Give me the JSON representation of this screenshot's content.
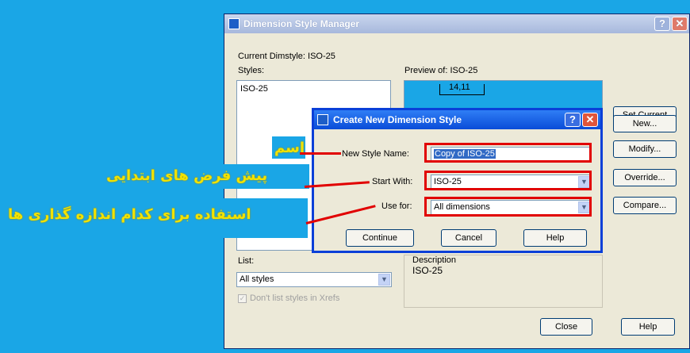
{
  "main_dialog": {
    "title": "Dimension Style Manager",
    "current_dimstyle": "Current Dimstyle: ISO-25",
    "styles_label": "Styles:",
    "styles": [
      "ISO-25"
    ],
    "preview_label": "Preview of: ISO-25",
    "preview_dimension": "14,11",
    "buttons": {
      "set_current": "Set Current",
      "new": "New...",
      "modify": "Modify...",
      "override": "Override...",
      "compare": "Compare...",
      "close": "Close",
      "help": "Help"
    },
    "list_label": "List:",
    "list_value": "All styles",
    "xrefs_checkbox": "Don't list styles in Xrefs",
    "description_label": "Description",
    "description_value": "ISO-25"
  },
  "create_dialog": {
    "title": "Create New Dimension Style",
    "new_style_name_label": "New Style Name:",
    "new_style_name_value": "Copy of ISO-25",
    "start_with_label": "Start With:",
    "start_with_value": "ISO-25",
    "use_for_label": "Use for:",
    "use_for_value": "All dimensions",
    "buttons": {
      "continue": "Continue",
      "cancel": "Cancel",
      "help": "Help"
    }
  },
  "annotations": {
    "name": "اسم",
    "start_with": "پیش فرض های ابتدایی",
    "use_for": "استفاده برای کدام اندازه گذاری ها"
  },
  "colors": {
    "background": "#1aa6e6",
    "annotation_text": "#f2e200",
    "highlight_box": "#e10000"
  }
}
